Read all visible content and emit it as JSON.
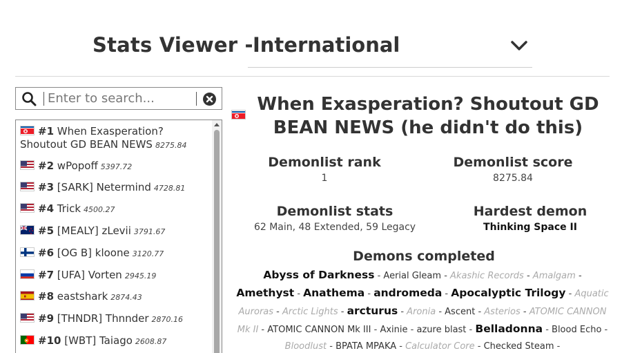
{
  "header": {
    "title": "Stats Viewer - ",
    "region": "International"
  },
  "search": {
    "placeholder": "Enter to search..."
  },
  "players": [
    {
      "rank": "#1",
      "name": "When Exasperation? Shoutout GD BEAN NEWS",
      "name_line1": "When Exasperation?",
      "name_line2": "Shoutout GD BEAN NEWS",
      "score": "8275.84",
      "flag": "north-korea"
    },
    {
      "rank": "#2",
      "name": "wPopoff",
      "score": "5397.72",
      "flag": "usa"
    },
    {
      "rank": "#3",
      "name": "[SARK] Netermind",
      "score": "4728.81",
      "flag": "usa"
    },
    {
      "rank": "#4",
      "name": "Trick",
      "score": "4500.27",
      "flag": "usa"
    },
    {
      "rank": "#5",
      "name": "[MEALY] zLevii",
      "score": "3791.67",
      "flag": "new-zealand"
    },
    {
      "rank": "#6",
      "name": "[OG B] kloone",
      "score": "3120.77",
      "flag": "finland"
    },
    {
      "rank": "#7",
      "name": "[UFA] Vorten",
      "score": "2945.19",
      "flag": "russia"
    },
    {
      "rank": "#8",
      "name": "eastshark",
      "score": "2874.43",
      "flag": "spain"
    },
    {
      "rank": "#9",
      "name": "[THNDR] Thnnder",
      "score": "2870.16",
      "flag": "usa"
    },
    {
      "rank": "#10",
      "name": "[WBT] Taiago",
      "score": "2608.87",
      "flag": "portugal"
    }
  ],
  "player": {
    "name": "When Exasperation? Shoutout GD BEAN NEWS (he didn't do this)",
    "flag": "north-korea",
    "rank_label": "Demonlist rank",
    "rank_value": "1",
    "score_label": "Demonlist score",
    "score_value": "8275.84",
    "stats_label": "Demonlist stats",
    "stats_value": "62 Main, 48 Extended, 59 Legacy",
    "hardest_label": "Hardest demon",
    "hardest_value": "Thinking Space II",
    "demons_label": "Demons completed"
  },
  "demons": [
    {
      "name": "Abyss of Darkness",
      "type": "main"
    },
    {
      "name": "Aerial Gleam",
      "type": "extended"
    },
    {
      "name": "Akashic Records",
      "type": "legacy"
    },
    {
      "name": "Amalgam",
      "type": "legacy"
    },
    {
      "name": "Amethyst",
      "type": "main"
    },
    {
      "name": "Anathema",
      "type": "main"
    },
    {
      "name": "andromeda",
      "type": "main"
    },
    {
      "name": "Apocalyptic Trilogy",
      "type": "main"
    },
    {
      "name": "Aquatic Auroras",
      "type": "legacy"
    },
    {
      "name": "Arctic Lights",
      "type": "legacy"
    },
    {
      "name": "arcturus",
      "type": "main"
    },
    {
      "name": "Aronia",
      "type": "legacy"
    },
    {
      "name": "Ascent",
      "type": "extended"
    },
    {
      "name": "Asterios",
      "type": "legacy"
    },
    {
      "name": "ATOMIC CANNON Mk II",
      "type": "legacy"
    },
    {
      "name": "ATOMIC CANNON Mk III",
      "type": "extended"
    },
    {
      "name": "Axinie",
      "type": "extended"
    },
    {
      "name": "azure blast",
      "type": "extended"
    },
    {
      "name": "Belladonna",
      "type": "main"
    },
    {
      "name": "Blood Echo",
      "type": "extended"
    },
    {
      "name": "Bloodlust",
      "type": "legacy"
    },
    {
      "name": "BPATA MPAKA",
      "type": "extended"
    },
    {
      "name": "Calculator Core",
      "type": "legacy"
    },
    {
      "name": "Checked Steam",
      "type": "extended"
    }
  ],
  "colors": {
    "text": "#333333",
    "legacy": "#aaaaaa",
    "divider": "#d8d8d8"
  }
}
